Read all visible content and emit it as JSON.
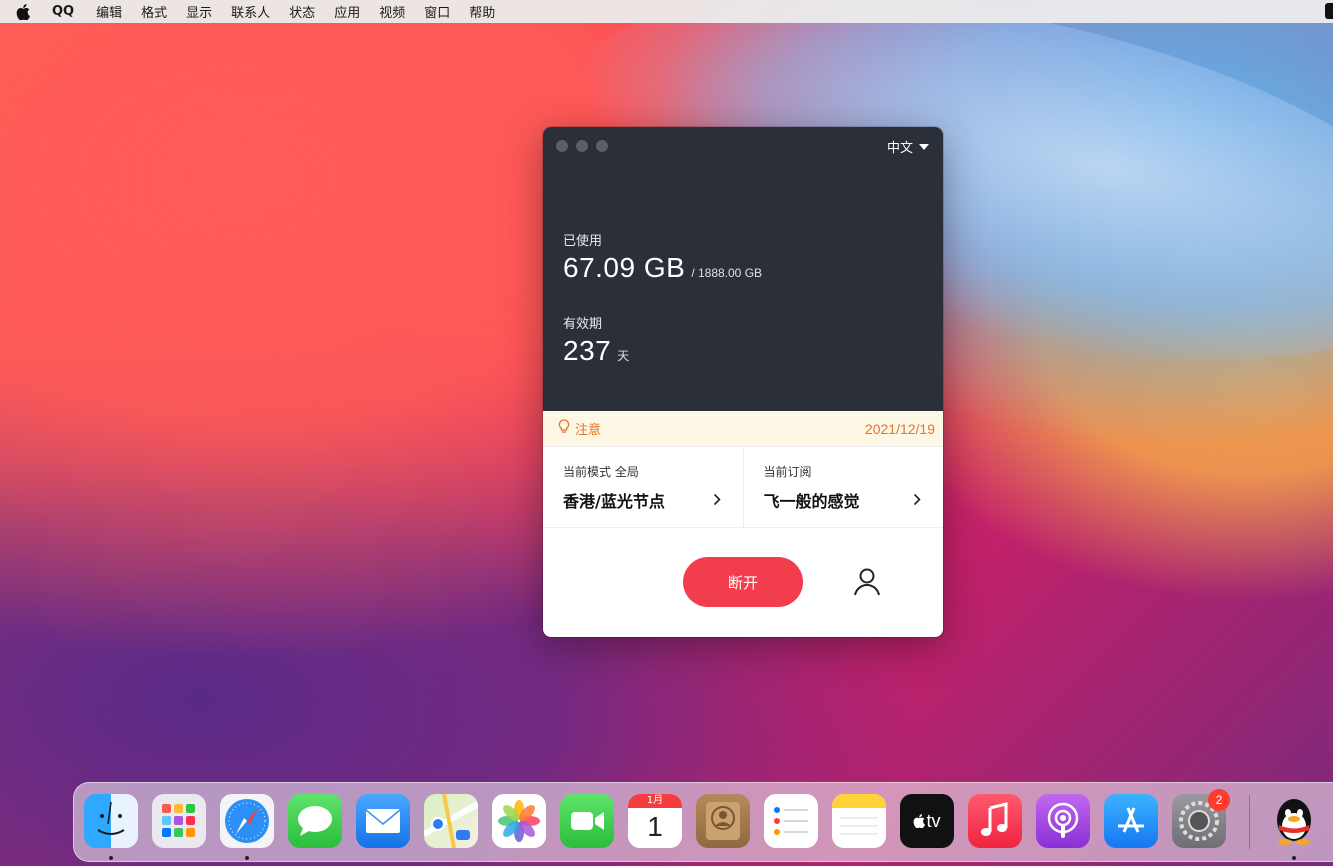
{
  "menubar": {
    "app_name": "QQ",
    "items": [
      "编辑",
      "格式",
      "显示",
      "联系人",
      "状态",
      "应用",
      "视频",
      "窗口",
      "帮助"
    ]
  },
  "window": {
    "language": "中文",
    "usage": {
      "label": "已使用",
      "used": "67.09 GB",
      "total": "/ 1888.00 GB"
    },
    "validity": {
      "label": "有效期",
      "value": "237",
      "unit": "天"
    },
    "notice": {
      "label": "注意",
      "date": "2021/12/19"
    },
    "mode": {
      "label": "当前模式 全局",
      "value": "香港/蓝光节点"
    },
    "subscription": {
      "label": "当前订阅",
      "value": "飞一般的感觉"
    },
    "disconnect_label": "断开"
  },
  "dock": {
    "calendar_month": "1月",
    "calendar_day": "1",
    "tv_label": "tv",
    "settings_badge": "2",
    "apps": [
      "finder-icon",
      "launchpad-icon",
      "safari-icon",
      "messages-icon",
      "mail-icon",
      "maps-icon",
      "photos-icon",
      "facetime-icon",
      "calendar-icon",
      "contacts-icon",
      "reminders-icon",
      "notes-icon",
      "apple-tv-icon",
      "music-icon",
      "podcasts-icon",
      "app-store-icon",
      "system-preferences-icon",
      "qq-icon"
    ]
  },
  "colors": {
    "accent_red": "#f23d4d",
    "notice_orange": "#e8732a",
    "panel_dark": "#2b2f38"
  }
}
